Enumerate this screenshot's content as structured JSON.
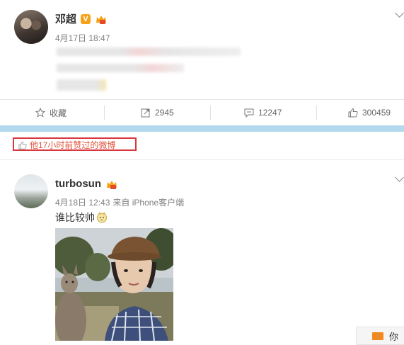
{
  "post1": {
    "username": "邓超",
    "verified_badge": "V",
    "time": "4月17日 18:47"
  },
  "actions": {
    "favorite_label": "收藏",
    "repost_count": "2945",
    "comment_count": "12247",
    "like_count": "300459"
  },
  "liked_notice": "他17小时前赞过的微博",
  "post2": {
    "username": "turbosun",
    "time": "4月18日 12:43",
    "source": "来自 iPhone客户端",
    "text": "谁比较帅"
  },
  "feedback_label": "你",
  "colors": {
    "accent_orange": "#f4a21a",
    "highlight_red": "#d9373d",
    "blue_bar": "#b3d9ee"
  }
}
